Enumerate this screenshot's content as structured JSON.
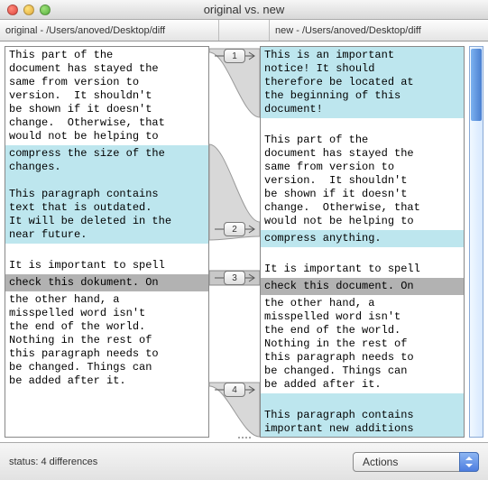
{
  "window": {
    "title": "original vs. new"
  },
  "header": {
    "left": "original - /Users/anoved/Desktop/diff",
    "right": "new - /Users/anoved/Desktop/diff"
  },
  "diff": {
    "markers": [
      {
        "n": "1"
      },
      {
        "n": "2"
      },
      {
        "n": "3"
      },
      {
        "n": "4"
      }
    ]
  },
  "left": {
    "b1": "This part of the\ndocument has stayed the\nsame from version to\nversion.  It shouldn't\nbe shown if it doesn't\nchange.  Otherwise, that\nwould not be helping to",
    "b1hl": "compress the size of the\nchanges.\n\nThis paragraph contains\ntext that is outdated.\nIt will be deleted in the\nnear future.",
    "b2a": "\nIt is important to spell",
    "b2row": "check this dokument. On",
    "b2b": "the other hand, a\nmisspelled word isn't\nthe end of the world.\nNothing in the rest of\nthis paragraph needs to\nbe changed. Things can\nbe added after it."
  },
  "right": {
    "r0hl": "This is an important\nnotice! It should\ntherefore be located at\nthe beginning of this\ndocument!",
    "r1": "\nThis part of the\ndocument has stayed the\nsame from version to\nversion.  It shouldn't\nbe shown if it doesn't\nchange.  Otherwise, that\nwould not be helping to",
    "r1hl": "compress anything.",
    "r2a": "\nIt is important to spell",
    "r2row": "check this document. On",
    "r2b": "the other hand, a\nmisspelled word isn't\nthe end of the world.\nNothing in the rest of\nthis paragraph needs to\nbe changed. Things can\nbe added after it.",
    "r3hl": "\nThis paragraph contains\nimportant new additions\nto this document."
  },
  "footer": {
    "status": "status: 4 differences",
    "actions_label": "Actions"
  }
}
